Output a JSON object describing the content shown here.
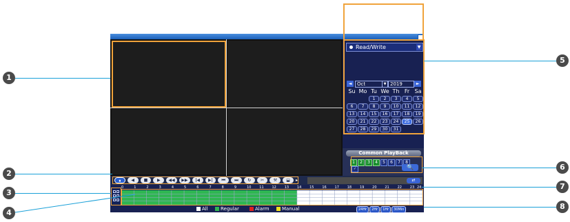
{
  "rw_select": {
    "value": "Read/Write"
  },
  "calendar": {
    "prev_arrow": "◄",
    "next_arrow": "►",
    "month": "Oct",
    "year": "2019",
    "weekdays": [
      "Su",
      "Mo",
      "Tu",
      "We",
      "Th",
      "Fr",
      "Sa"
    ],
    "days": [
      "",
      "",
      "1",
      "2",
      "3",
      "4",
      "5",
      "6",
      "7",
      "8",
      "9",
      "10",
      "11",
      "12",
      "13",
      "14",
      "15",
      "16",
      "17",
      "18",
      "19",
      "20",
      "21",
      "22",
      "23",
      "24",
      "25",
      "26",
      "27",
      "28",
      "29",
      "30",
      "31",
      "",
      "",
      "",
      ""
    ],
    "selected_day": "25"
  },
  "common_playback": {
    "title": "Common PlayBack",
    "channels": [
      "1",
      "2",
      "3",
      "4",
      "5",
      "6",
      "7",
      "8"
    ],
    "active_channels": [
      "1",
      "2",
      "3",
      "4"
    ],
    "search_icon": "🔍"
  },
  "controls": [
    "⏸",
    "◀",
    "■",
    "▶",
    "◀◀",
    "▶▶",
    "|◀",
    "▶|",
    "⏮",
    "⏭",
    "↻",
    "✂",
    "⚒",
    "⬓"
  ],
  "controls_more": "▸",
  "timeline": {
    "hours": [
      "0",
      "1",
      "2",
      "3",
      "4",
      "5",
      "6",
      "7",
      "8",
      "9",
      "10",
      "11",
      "12",
      "13",
      "14",
      "15",
      "16",
      "17",
      "18",
      "19",
      "20",
      "21",
      "22",
      "23",
      "24"
    ],
    "recorded_hours": 14
  },
  "legend": {
    "all": "All",
    "regular": "Regular",
    "alarm": "Alarm",
    "manual": "Manual",
    "colors": {
      "all": "#ffffff",
      "regular": "#2fb652",
      "alarm": "#e02020",
      "manual": "#f0e020"
    }
  },
  "zoom_buttons": [
    "24Hr",
    "2Hr",
    "1Hr",
    "30Min"
  ],
  "callouts": [
    "1",
    "2",
    "3",
    "4",
    "5",
    "6",
    "7",
    "8"
  ]
}
